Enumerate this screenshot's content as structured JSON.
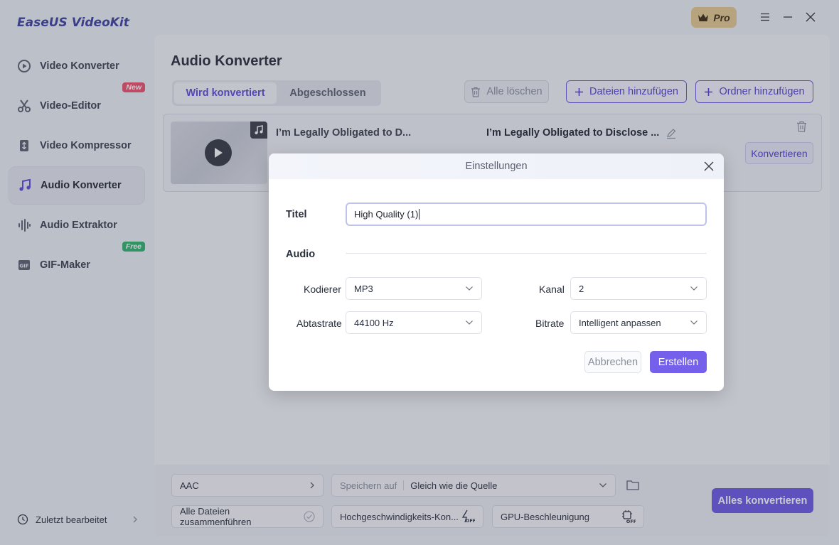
{
  "app": {
    "title": "EaseUS VideoKit",
    "pro_label": "Pro"
  },
  "sidebar": {
    "items": [
      {
        "label": "Video Konverter",
        "icon": "video-convert-icon"
      },
      {
        "label": "Video-Editor",
        "icon": "scissors-icon",
        "badge": "New"
      },
      {
        "label": "Video Kompressor",
        "icon": "compress-icon"
      },
      {
        "label": "Audio Konverter",
        "icon": "music-note-icon"
      },
      {
        "label": "Audio Extraktor",
        "icon": "waveform-icon"
      },
      {
        "label": "GIF-Maker",
        "icon": "gif-icon",
        "badge": "Free"
      }
    ],
    "recent": "Zuletzt bearbeitet"
  },
  "main": {
    "title": "Audio Konverter",
    "tabs": [
      "Wird konvertiert",
      "Abgeschlossen"
    ],
    "delete_all": "Alle löschen",
    "add_files": "Dateien hinzufügen",
    "add_folder": "Ordner hinzufügen",
    "file": {
      "source_name": "I’m Legally Obligated to D...",
      "target_name": "I’m Legally Obligated to Disclose ...",
      "convert_label": "Konvertieren"
    }
  },
  "bottom": {
    "format": "AAC",
    "save_label": "Speichern auf",
    "save_value": "Gleich wie die Quelle",
    "merge": "Alle Dateien zusammenführen",
    "highspeed": "Hochgeschwindigkeits-Kon...",
    "gpu": "GPU-Beschleunigung",
    "convert_all": "Alles konvertieren"
  },
  "dialog": {
    "title": "Einstellungen",
    "title_label": "Titel",
    "title_value": "High Quality (1)",
    "section_audio": "Audio",
    "encoder_label": "Kodierer",
    "encoder_value": "MP3",
    "channel_label": "Kanal",
    "channel_value": "2",
    "samplerate_label": "Abtastrate",
    "samplerate_value": "44100 Hz",
    "bitrate_label": "Bitrate",
    "bitrate_value": "Intelligent anpassen",
    "cancel": "Abbrechen",
    "create": "Erstellen"
  },
  "colors": {
    "accent": "#6b58e6",
    "new_badge": "#ef4f6b",
    "free_badge": "#2fb36b"
  }
}
